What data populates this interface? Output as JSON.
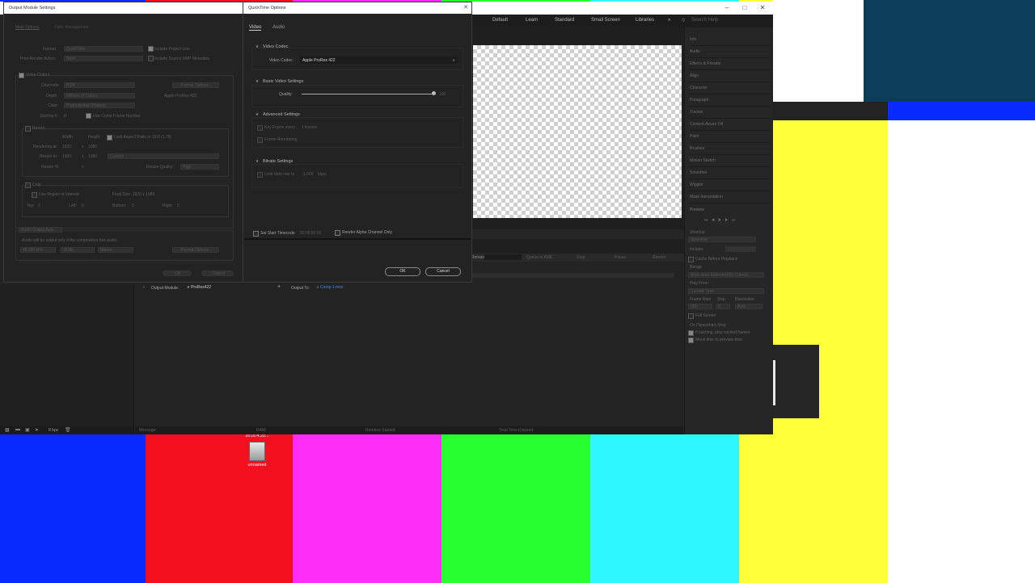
{
  "colors": {
    "blue": "#0a2bff",
    "red": "#f20f1e",
    "magenta": "#ff2bf6",
    "green": "#27ff2e",
    "cyan": "#2ef7ff",
    "yellow": "#ffff3a",
    "dark_teal": "#0d3e59",
    "panel": "#232323"
  },
  "output_module": {
    "title": "Output Module Settings",
    "tabs": [
      "Main Options",
      "Color Management"
    ],
    "format_label": "Format:",
    "format_value": "QuickTime",
    "include_project_link": "Include Project Link",
    "post_render_label": "Post-Render Action:",
    "post_render_value": "None",
    "include_xmp": "Include Source XMP Metadata",
    "video_output": "Video Output",
    "channels_label": "Channels:",
    "channels_value": "RGB",
    "depth_label": "Depth:",
    "depth_value": "Millions of Colors",
    "color_label": "Color:",
    "color_value": "Premultiplied (Matted)",
    "starting_label": "Starting #:",
    "starting_value": "0",
    "use_comp_frame": "Use Comp Frame Number",
    "format_options_btn": "Format Options...",
    "codec_value": "Apple ProRes 422",
    "resize": "Resize",
    "width_label": "Width",
    "height_label": "Height",
    "lock_aspect": "Lock Aspect Ratio to 16:9 (1.78)",
    "rendering_at_label": "Rendering at:",
    "rendering_at_w": "1920",
    "rendering_at_h": "1080",
    "resize_to_label": "Resize to:",
    "resize_to_w": "1920",
    "resize_to_h": "1080",
    "resize_to_preset": "Custom",
    "resize_pct_label": "Resize %:",
    "resize_pct_x": "x",
    "resize_quality_label": "Resize Quality:",
    "resize_quality_value": "High",
    "crop": "Crop",
    "use_roi": "Use Region of Interest",
    "final_size": "Final Size: 1920 x 1080",
    "top_label": "Top:",
    "top_value": "0",
    "left_label": "Left:",
    "left_value": "0",
    "bottom_label": "Bottom:",
    "bottom_value": "0",
    "right_label": "Right:",
    "right_value": "0",
    "audio_output": "Audio Output Auto",
    "audio_note": "Audio will be output only if the composition has audio.",
    "audio_rate": "48.000 kHz",
    "audio_bits": "16 Bit",
    "audio_channels": "Stereo",
    "audio_format_options": "Format Options...",
    "ok": "OK",
    "cancel": "Cancel"
  },
  "quicktime": {
    "title": "QuickTime Options",
    "tabs": [
      "Video",
      "Audio"
    ],
    "video_codec_section": "Video Codec",
    "video_codec_label": "Video Codec:",
    "video_codec_value": "Apple ProRes 422",
    "basic_section": "Basic Video Settings",
    "quality_label": "Quality:",
    "quality_value": "100",
    "quality_fraction": 1.0,
    "advanced_section": "Advanced Settings",
    "key_frame": "Key Frame every",
    "key_frame_value": "1",
    "key_frame_unit": "frames",
    "frame_reordering": "Frame Reordering",
    "bitrate_section": "Bitrate Settings",
    "limit_data_rate": "Limit data rate to",
    "limit_value": "1,000",
    "limit_unit": "kbps",
    "set_start_timecode": "Set Start Timecode",
    "timecode_value": "00:00:00:00",
    "render_alpha": "Render Alpha Channel Only",
    "ok": "OK",
    "cancel": "Cancel"
  },
  "workspace": {
    "items": [
      "Default",
      "Learn",
      "Standard",
      "Small Screen",
      "Libraries"
    ],
    "search_placeholder": "Search Help"
  },
  "right_panel": {
    "items": [
      "Info",
      "Audio",
      "Effects & Presets",
      "Align",
      "Character",
      "Paragraph",
      "Tracker",
      "Content-Aware Fill",
      "Paint",
      "Brushes",
      "Motion Sketch",
      "Smoother",
      "Wiggler",
      "Mask Interpolation"
    ],
    "preview": "Preview",
    "shortcut_label": "Shortcut",
    "shortcut_value": "Spacebar",
    "include_label": "Include:",
    "cache_before": "Cache Before Playback",
    "range_label": "Range",
    "range_value": "Work Area Extended By Current...",
    "play_from_label": "Play From",
    "play_from_value": "Current Time",
    "frame_rate_label": "Frame Rate",
    "skip_label": "Skip",
    "resolution_label": "Resolution",
    "frame_rate_value": "(25)",
    "skip_value": "0",
    "resolution_value": "Auto",
    "full_screen": "Full Screen",
    "on_stop": "On (Spacebar) Stop:",
    "if_caching": "If caching, play cached frames",
    "move_time": "Move time to preview time"
  },
  "render_queue": {
    "output_module_label": "Output Module:",
    "output_module_value": "ProRes422",
    "output_to_label": "Output To:",
    "output_to_value": "Comp 1.mov",
    "remain_label": "Remain",
    "queue_in_ame": "Queue in AME",
    "stop": "Stop",
    "pause": "Pause",
    "render": "Render",
    "status_message": "Message:",
    "status_ram": "RAM:",
    "status_started": "Renders Started:",
    "status_elapsed": "Total Time Elapsed:",
    "bpc": "8 bpc"
  },
  "desktop_icon": {
    "label_top": "2018.4.20...",
    "label": "unnamed"
  }
}
